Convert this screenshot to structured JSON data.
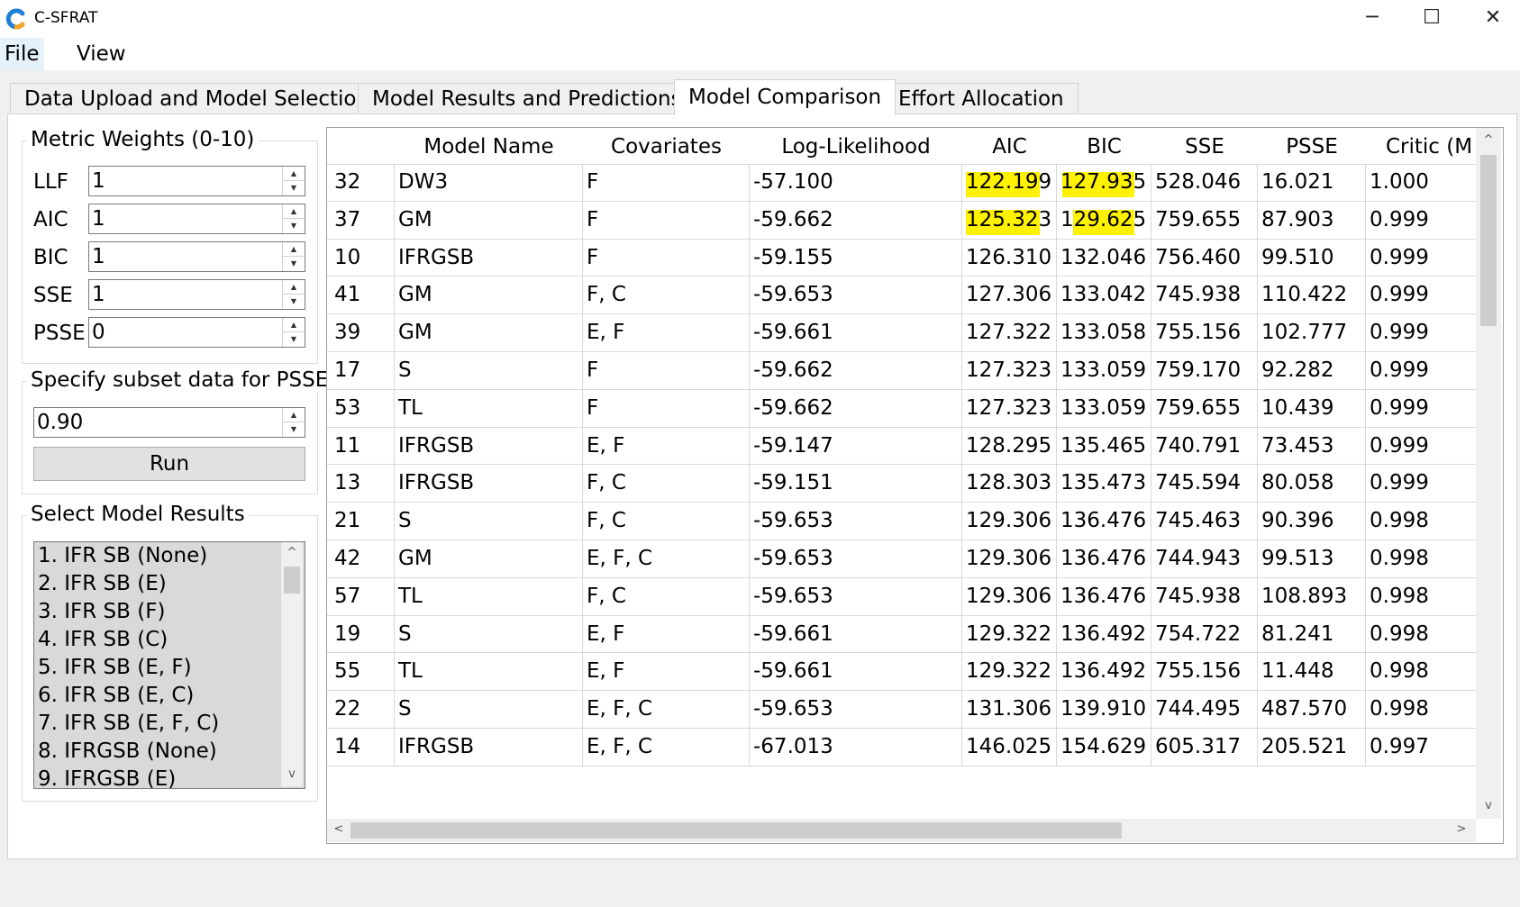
{
  "window": {
    "title": "C-SFRAT",
    "minimize": "─",
    "maximize": "☐",
    "close": "✕"
  },
  "menu": {
    "file": "File",
    "view": "View"
  },
  "tabs": [
    {
      "label": "Data Upload and Model Selection",
      "active": false
    },
    {
      "label": "Model Results and Predictions",
      "active": false
    },
    {
      "label": "Model Comparison",
      "active": true
    },
    {
      "label": "Effort Allocation",
      "active": false
    }
  ],
  "metric_weights": {
    "title": "Metric Weights (0-10)",
    "fields": [
      {
        "label": "LLF",
        "value": "1"
      },
      {
        "label": "AIC",
        "value": "1"
      },
      {
        "label": "BIC",
        "value": "1"
      },
      {
        "label": "SSE",
        "value": "1"
      },
      {
        "label": "PSSE",
        "value": "0"
      }
    ]
  },
  "psse_subset": {
    "title": "Specify subset data for PSSE",
    "value": "0.90",
    "run_label": "Run"
  },
  "model_results": {
    "title": "Select Model Results",
    "items": [
      "1. IFR SB (None)",
      "2. IFR SB (E)",
      "3. IFR SB (F)",
      "4. IFR SB (C)",
      "5. IFR SB (E, F)",
      "6. IFR SB (E, C)",
      "7. IFR SB (E, F, C)",
      "8. IFRGSB (None)",
      "9. IFRGSB (E)"
    ]
  },
  "table": {
    "columns": [
      "",
      "Model Name",
      "Covariates",
      "Log-Likelihood",
      "AIC",
      "BIC",
      "SSE",
      "PSSE",
      "Critic (M"
    ],
    "sort_indicator": "^",
    "rows": [
      [
        "32",
        "DW3",
        "F",
        "-57.100",
        "122.199",
        "127.935",
        "528.046",
        "16.021",
        "1.000"
      ],
      [
        "37",
        "GM",
        "F",
        "-59.662",
        "125.323",
        "129.625",
        "759.655",
        "87.903",
        "0.999"
      ],
      [
        "10",
        "IFRGSB",
        "F",
        "-59.155",
        "126.310",
        "132.046",
        "756.460",
        "99.510",
        "0.999"
      ],
      [
        "41",
        "GM",
        "F, C",
        "-59.653",
        "127.306",
        "133.042",
        "745.938",
        "110.422",
        "0.999"
      ],
      [
        "39",
        "GM",
        "E, F",
        "-59.661",
        "127.322",
        "133.058",
        "755.156",
        "102.777",
        "0.999"
      ],
      [
        "17",
        "S",
        "F",
        "-59.662",
        "127.323",
        "133.059",
        "759.170",
        "92.282",
        "0.999"
      ],
      [
        "53",
        "TL",
        "F",
        "-59.662",
        "127.323",
        "133.059",
        "759.655",
        "10.439",
        "0.999"
      ],
      [
        "11",
        "IFRGSB",
        "E, F",
        "-59.147",
        "128.295",
        "135.465",
        "740.791",
        "73.453",
        "0.999"
      ],
      [
        "13",
        "IFRGSB",
        "F, C",
        "-59.151",
        "128.303",
        "135.473",
        "745.594",
        "80.058",
        "0.999"
      ],
      [
        "21",
        "S",
        "F, C",
        "-59.653",
        "129.306",
        "136.476",
        "745.463",
        "90.396",
        "0.998"
      ],
      [
        "42",
        "GM",
        "E, F, C",
        "-59.653",
        "129.306",
        "136.476",
        "744.943",
        "99.513",
        "0.998"
      ],
      [
        "57",
        "TL",
        "F, C",
        "-59.653",
        "129.306",
        "136.476",
        "745.938",
        "108.893",
        "0.998"
      ],
      [
        "19",
        "S",
        "E, F",
        "-59.661",
        "129.322",
        "136.492",
        "754.722",
        "81.241",
        "0.998"
      ],
      [
        "55",
        "TL",
        "E, F",
        "-59.661",
        "129.322",
        "136.492",
        "755.156",
        "11.448",
        "0.998"
      ],
      [
        "22",
        "S",
        "E, F, C",
        "-59.653",
        "131.306",
        "139.910",
        "744.495",
        "487.570",
        "0.998"
      ],
      [
        "14",
        "IFRGSB",
        "E, F, C",
        "-67.013",
        "146.025",
        "154.629",
        "605.317",
        "205.521",
        "0.997"
      ]
    ],
    "highlight_color": "#fff200"
  },
  "icons": {
    "up": "▲",
    "down": "▼",
    "left": "<",
    "right": ">",
    "list_up": "^",
    "list_down": "v"
  }
}
